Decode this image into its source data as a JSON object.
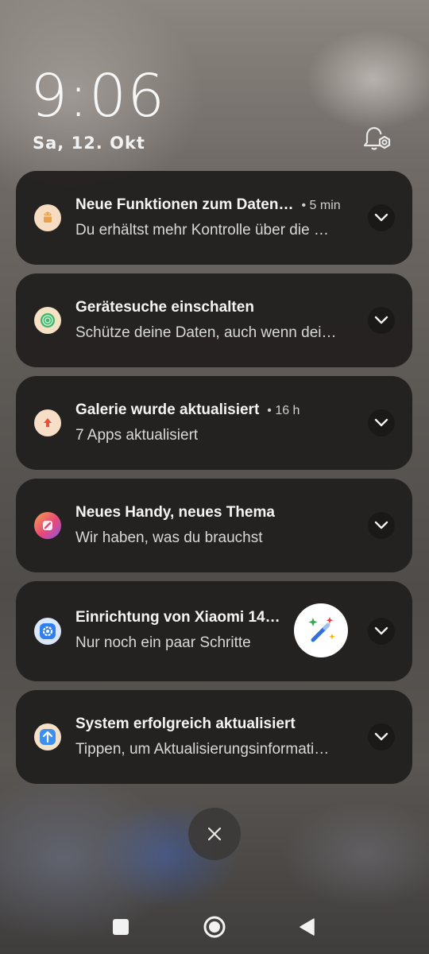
{
  "lockscreen": {
    "time": "9:06",
    "date": "Sa, 12. Okt"
  },
  "notifications": [
    {
      "title": "Neue Funktionen zum Daten…",
      "time": "• 5 min",
      "body": "Du erhältst mehr Kontrolle über die …",
      "icon": "android-icon",
      "icon_color": "#e9a24b"
    },
    {
      "title": "Gerätesuche einschalten",
      "time": "",
      "body": "Schütze deine Daten, auch wenn dei…",
      "icon": "find-device-icon",
      "icon_color": "#3fb56b"
    },
    {
      "title": "Galerie wurde aktualisiert",
      "time": "• 16 h",
      "body": "7 Apps aktualisiert",
      "icon": "update-arrow-icon",
      "icon_color": "#e0533a"
    },
    {
      "title": "Neues Handy, neues Thema",
      "time": "",
      "body": "Wir haben, was du brauchst",
      "icon": "themes-brush-icon",
      "icon_color": "#e8477a"
    },
    {
      "title": "Einrichtung von Xiaomi 14…",
      "time": "",
      "body": "Nur noch ein paar Schritte",
      "icon": "settings-gear-icon",
      "icon_color": "#2f7ff0"
    },
    {
      "title": "System erfolgreich aktualisiert",
      "time": "",
      "body": "Tippen, um Aktualisierungsinformati…",
      "icon": "system-update-icon",
      "icon_color": "#3d8ff0"
    }
  ],
  "icons": {
    "notification_settings": "bell-settings-icon",
    "expand": "chevron-down-icon",
    "magic": "magic-wand-icon",
    "clear_all": "close-icon",
    "nav_recents": "square-icon",
    "nav_home": "circle-icon",
    "nav_back": "triangle-back-icon"
  }
}
